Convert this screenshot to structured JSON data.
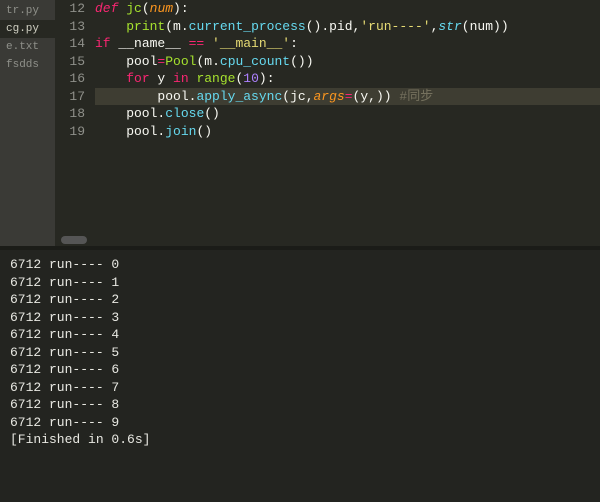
{
  "sidebar": {
    "tabs": [
      {
        "label": "tr.py",
        "active": false
      },
      {
        "label": "cg.py",
        "active": true
      },
      {
        "label": "e.txt",
        "active": false
      },
      {
        "label": "fsdds",
        "active": false
      }
    ]
  },
  "editor": {
    "line_start": 12,
    "highlight_line": 17,
    "lines": [
      {
        "n": 12,
        "tokens": [
          [
            "kw",
            "def "
          ],
          [
            "fn",
            "jc"
          ],
          [
            "punc",
            "("
          ],
          [
            "arg",
            "num"
          ],
          [
            "punc",
            ")"
          ],
          [
            "punc",
            ":"
          ]
        ]
      },
      {
        "n": 13,
        "tokens": [
          [
            "id",
            "    "
          ],
          [
            "callg",
            "print"
          ],
          [
            "punc",
            "("
          ],
          [
            "id",
            "m"
          ],
          [
            "punc",
            "."
          ],
          [
            "call",
            "current_process"
          ],
          [
            "punc",
            "()"
          ],
          [
            "punc",
            "."
          ],
          [
            "id",
            "pid"
          ],
          [
            "punc",
            ","
          ],
          [
            "str",
            "'run----'"
          ],
          [
            "punc",
            ","
          ],
          [
            "builtin",
            "str"
          ],
          [
            "punc",
            "("
          ],
          [
            "id",
            "num"
          ],
          [
            "punc",
            ")"
          ],
          [
            "punc",
            ")"
          ]
        ]
      },
      {
        "n": 14,
        "tokens": [
          [
            "kwp",
            "if"
          ],
          [
            "id",
            " __name__ "
          ],
          [
            "kwp",
            "=="
          ],
          [
            "id",
            " "
          ],
          [
            "str",
            "'__main__'"
          ],
          [
            "punc",
            ":"
          ]
        ]
      },
      {
        "n": 15,
        "tokens": [
          [
            "id",
            "    pool"
          ],
          [
            "kwp",
            "="
          ],
          [
            "callg",
            "Pool"
          ],
          [
            "punc",
            "("
          ],
          [
            "id",
            "m"
          ],
          [
            "punc",
            "."
          ],
          [
            "call",
            "cpu_count"
          ],
          [
            "punc",
            "()"
          ],
          [
            "punc",
            ")"
          ]
        ]
      },
      {
        "n": 16,
        "tokens": [
          [
            "id",
            "    "
          ],
          [
            "kwp",
            "for"
          ],
          [
            "id",
            " y "
          ],
          [
            "kwp",
            "in"
          ],
          [
            "id",
            " "
          ],
          [
            "callg",
            "range"
          ],
          [
            "punc",
            "("
          ],
          [
            "num",
            "10"
          ],
          [
            "punc",
            ")"
          ],
          [
            "punc",
            ":"
          ]
        ]
      },
      {
        "n": 17,
        "tokens": [
          [
            "id",
            "        pool"
          ],
          [
            "punc",
            "."
          ],
          [
            "call",
            "apply_async"
          ],
          [
            "punc",
            "("
          ],
          [
            "id",
            "jc"
          ],
          [
            "punc",
            ","
          ],
          [
            "arg",
            "args"
          ],
          [
            "kwp",
            "="
          ],
          [
            "punc",
            "("
          ],
          [
            "id",
            "y"
          ],
          [
            "punc",
            ",)"
          ],
          [
            "punc",
            ")"
          ],
          [
            "id",
            " "
          ],
          [
            "cmt",
            "#同步"
          ]
        ]
      },
      {
        "n": 18,
        "tokens": [
          [
            "id",
            "    pool"
          ],
          [
            "punc",
            "."
          ],
          [
            "call",
            "close"
          ],
          [
            "punc",
            "()"
          ]
        ]
      },
      {
        "n": 19,
        "tokens": [
          [
            "id",
            "    pool"
          ],
          [
            "punc",
            "."
          ],
          [
            "call",
            "join"
          ],
          [
            "punc",
            "()"
          ]
        ]
      }
    ]
  },
  "output": {
    "lines": [
      "6712 run---- 0",
      "6712 run---- 1",
      "6712 run---- 2",
      "6712 run---- 3",
      "6712 run---- 4",
      "6712 run---- 5",
      "6712 run---- 6",
      "6712 run---- 7",
      "6712 run---- 8",
      "6712 run---- 9",
      "[Finished in 0.6s]"
    ]
  }
}
